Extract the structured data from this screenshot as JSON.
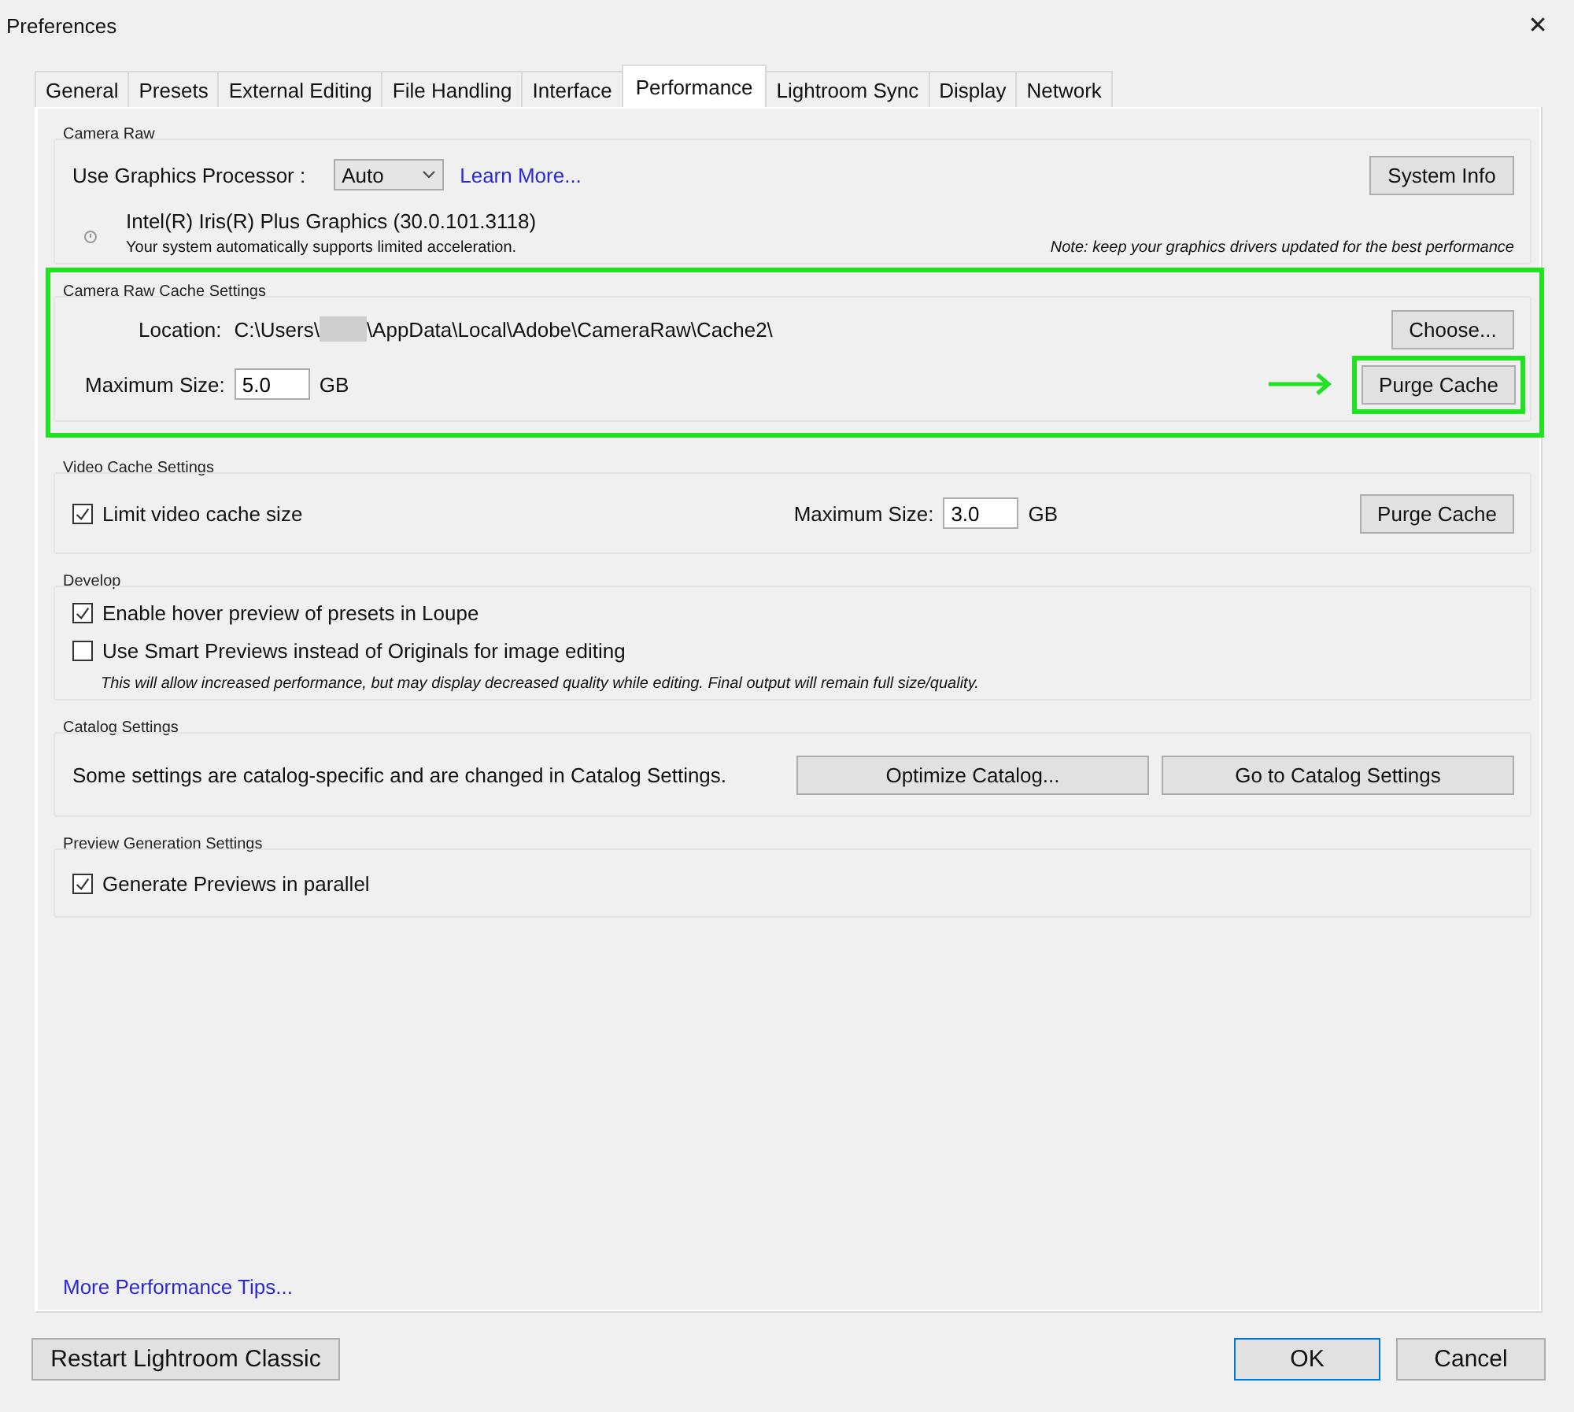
{
  "window": {
    "title": "Preferences",
    "close": "✕"
  },
  "tabs": [
    {
      "label": "General",
      "selected": false
    },
    {
      "label": "Presets",
      "selected": false
    },
    {
      "label": "External Editing",
      "selected": false
    },
    {
      "label": "File Handling",
      "selected": false
    },
    {
      "label": "Interface",
      "selected": false
    },
    {
      "label": "Performance",
      "selected": true
    },
    {
      "label": "Lightroom Sync",
      "selected": false
    },
    {
      "label": "Display",
      "selected": false
    },
    {
      "label": "Network",
      "selected": false
    }
  ],
  "camera_raw": {
    "title": "Camera Raw",
    "gpu_label": "Use Graphics Processor :",
    "gpu_value": "Auto",
    "learn_more": "Learn More...",
    "system_info": "System Info",
    "gpu_name": "Intel(R) Iris(R) Plus Graphics (30.0.101.3118)",
    "gpu_note": "Your system automatically supports limited acceleration.",
    "driver_note": "Note: keep your graphics drivers updated for the best performance"
  },
  "cache": {
    "title": "Camera Raw Cache Settings",
    "highlighted": true,
    "location_label": "Location:",
    "location_start": "C:\\Users\\",
    "location_end": "\\AppData\\Local\\Adobe\\CameraRaw\\Cache2\\",
    "choose": "Choose...",
    "max_label": "Maximum Size:",
    "max_value": "5.0",
    "unit": "GB",
    "purge": "Purge Cache",
    "purge_highlighted": true
  },
  "video": {
    "title": "Video Cache Settings",
    "limit_label": "Limit video cache size",
    "limit_checked": true,
    "max_label": "Maximum Size:",
    "max_value": "3.0",
    "unit": "GB",
    "purge": "Purge Cache"
  },
  "develop": {
    "title": "Develop",
    "options": [
      {
        "label": "Enable hover preview of presets in Loupe",
        "checked": true
      },
      {
        "label": "Use Smart Previews instead of Originals for image editing",
        "checked": false
      }
    ],
    "note": "This will allow increased performance, but may display decreased quality while editing. Final output will remain full size/quality."
  },
  "catalog": {
    "title": "Catalog Settings",
    "text": "Some settings are catalog-specific and are changed in Catalog Settings.",
    "buttons": [
      "Optimize Catalog...",
      "Go to Catalog Settings"
    ]
  },
  "preview": {
    "title": "Preview Generation Settings",
    "options": [
      {
        "label": "Generate Previews in parallel",
        "checked": true
      }
    ]
  },
  "tips_link": "More Performance Tips...",
  "footer": {
    "restart": "Restart Lightroom Classic",
    "ok": "OK",
    "cancel": "Cancel"
  }
}
